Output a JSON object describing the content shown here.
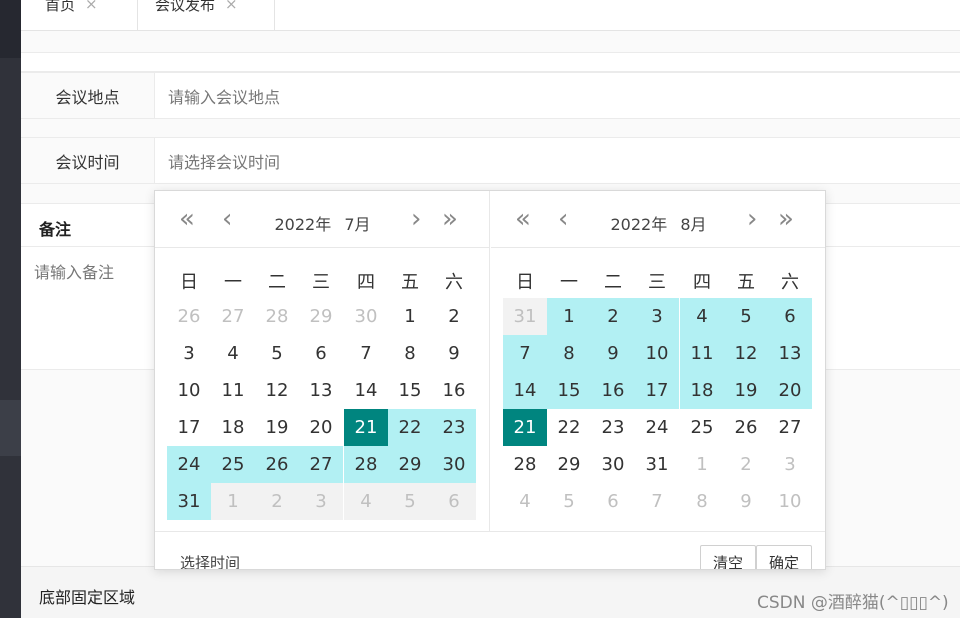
{
  "tabs": [
    {
      "label": "首页",
      "close": "×"
    },
    {
      "label": "会议发布",
      "close": "×"
    }
  ],
  "form": {
    "location": {
      "label": "会议地点",
      "placeholder": "请输入会议地点"
    },
    "time": {
      "label": "会议时间",
      "placeholder": "请选择会议时间"
    },
    "remark": {
      "label": "备注",
      "placeholder": "请输入备注"
    }
  },
  "footer": {
    "title": "底部固定区域",
    "watermark": "CSDN @酒醉猫(^▯▯▯^)"
  },
  "picker": {
    "nav": {
      "prev_year": "«",
      "prev_month": "‹",
      "next_month": "›",
      "next_year": "»"
    },
    "weekdays": [
      "日",
      "一",
      "二",
      "三",
      "四",
      "五",
      "六"
    ],
    "left": {
      "year": "2022年",
      "month": "7月"
    },
    "right": {
      "year": "2022年",
      "month": "8月"
    },
    "left_days": [
      [
        "26",
        "27",
        "28",
        "29",
        "30",
        "1",
        "2"
      ],
      [
        "3",
        "4",
        "5",
        "6",
        "7",
        "8",
        "9"
      ],
      [
        "10",
        "11",
        "12",
        "13",
        "14",
        "15",
        "16"
      ],
      [
        "17",
        "18",
        "19",
        "20",
        "21",
        "22",
        "23"
      ],
      [
        "24",
        "25",
        "26",
        "27",
        "28",
        "29",
        "30"
      ],
      [
        "31",
        "1",
        "2",
        "3",
        "4",
        "5",
        "6"
      ]
    ],
    "right_days": [
      [
        "31",
        "1",
        "2",
        "3",
        "4",
        "5",
        "6"
      ],
      [
        "7",
        "8",
        "9",
        "10",
        "11",
        "12",
        "13"
      ],
      [
        "14",
        "15",
        "16",
        "17",
        "18",
        "19",
        "20"
      ],
      [
        "21",
        "22",
        "23",
        "24",
        "25",
        "26",
        "27"
      ],
      [
        "28",
        "29",
        "30",
        "31",
        "1",
        "2",
        "3"
      ],
      [
        "4",
        "5",
        "6",
        "7",
        "8",
        "9",
        "10"
      ]
    ],
    "footer": {
      "select_time": "选择时间",
      "clear": "清空",
      "confirm": "确定"
    },
    "colors": {
      "range": "#b2f0f3",
      "selected": "#00857f"
    }
  }
}
